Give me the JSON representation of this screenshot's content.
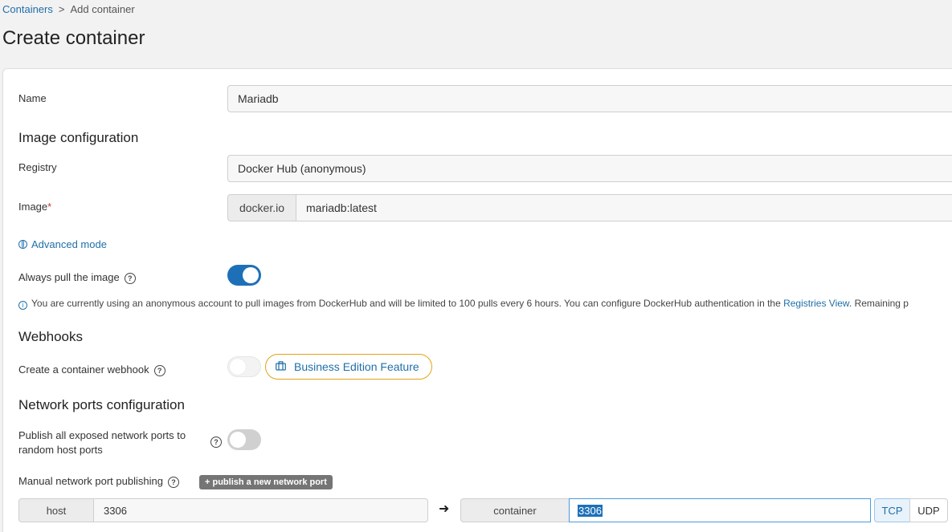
{
  "breadcrumb": {
    "root": "Containers",
    "separator": ">",
    "current": "Add container"
  },
  "page_title": "Create container",
  "name_field": {
    "label": "Name",
    "value": "Mariadb"
  },
  "image_config": {
    "title": "Image configuration",
    "registry_label": "Registry",
    "registry_value": "Docker Hub (anonymous)",
    "image_label": "Image",
    "image_required": "*",
    "image_prefix": "docker.io",
    "image_value": "mariadb:latest",
    "advanced_mode": "Advanced mode",
    "always_pull_label": "Always pull the image",
    "always_pull_on": true,
    "info_text": "You are currently using an anonymous account to pull images from DockerHub and will be limited to 100 pulls every 6 hours. You can configure DockerHub authentication in the ",
    "info_link": "Registries View",
    "info_tail": ". Remaining p"
  },
  "webhooks": {
    "title": "Webhooks",
    "label": "Create a container webhook",
    "badge": "Business Edition Feature"
  },
  "network": {
    "title": "Network ports configuration",
    "publish_all_label_1": "Publish all exposed network ports to",
    "publish_all_label_2": "random host ports",
    "manual_label": "Manual network port publishing",
    "add_button": "+ publish a new network port",
    "host_label": "host",
    "host_value": "3306",
    "container_label": "container",
    "container_value": "3306",
    "protocols": [
      "TCP",
      "UDP"
    ],
    "active_protocol": "TCP"
  },
  "colors": {
    "accent": "#1d70b8",
    "badge_border": "#e3a21a"
  }
}
